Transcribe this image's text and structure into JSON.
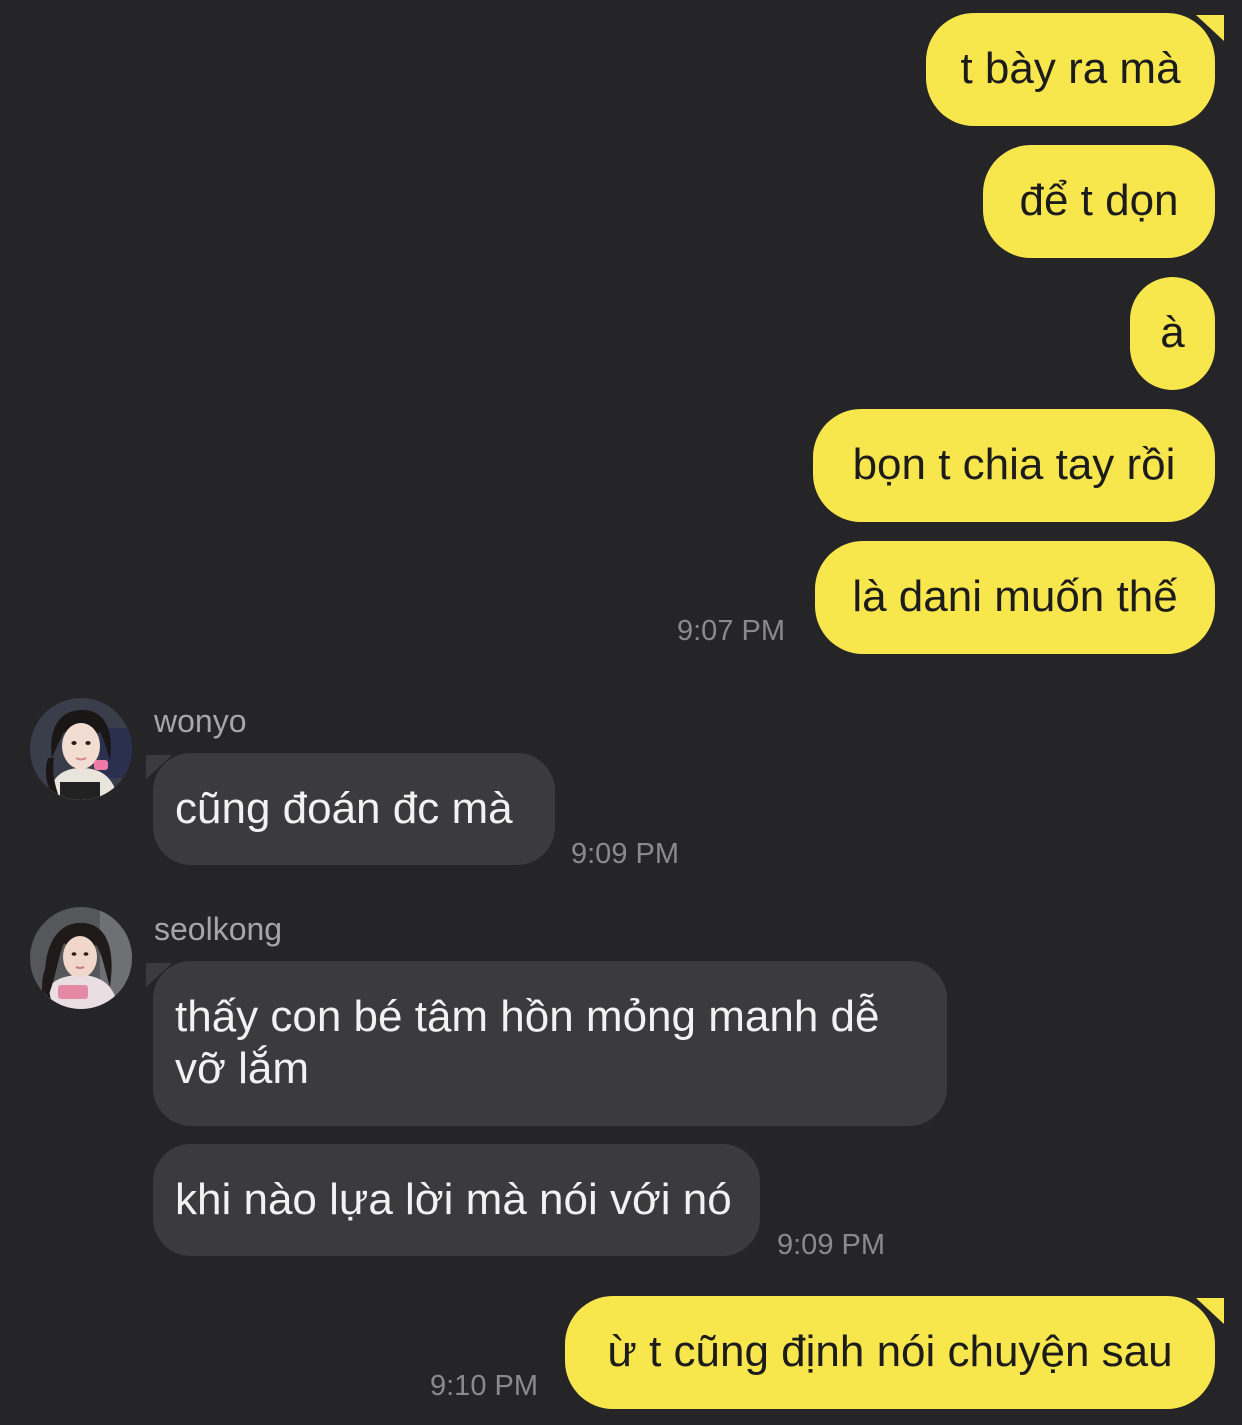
{
  "messages_out_1": [
    {
      "text": "t bày ra mà"
    },
    {
      "text": "để t dọn"
    },
    {
      "text": "à"
    },
    {
      "text": "bọn t chia tay rồi"
    },
    {
      "text": "là dani muốn thế"
    }
  ],
  "time_1": "9:07 PM",
  "wonyo": {
    "name": "wonyo",
    "message": "cũng đoán đc mà",
    "time": "9:09 PM"
  },
  "seolkong": {
    "name": "seolkong",
    "message_1_line_1": "thấy con bé tâm hồn mỏng manh dễ",
    "message_1_line_2": "vỡ lắm",
    "message_2": "khi nào lựa lời mà nói với nó",
    "time": "9:09 PM"
  },
  "last_out": {
    "text": "ừ t cũng định nói chuyện sau",
    "time": "9:10 PM"
  },
  "colors": {
    "background": "#252527",
    "outgoing_bubble": "#f8e64d",
    "incoming_bubble": "#3b3b3d"
  }
}
